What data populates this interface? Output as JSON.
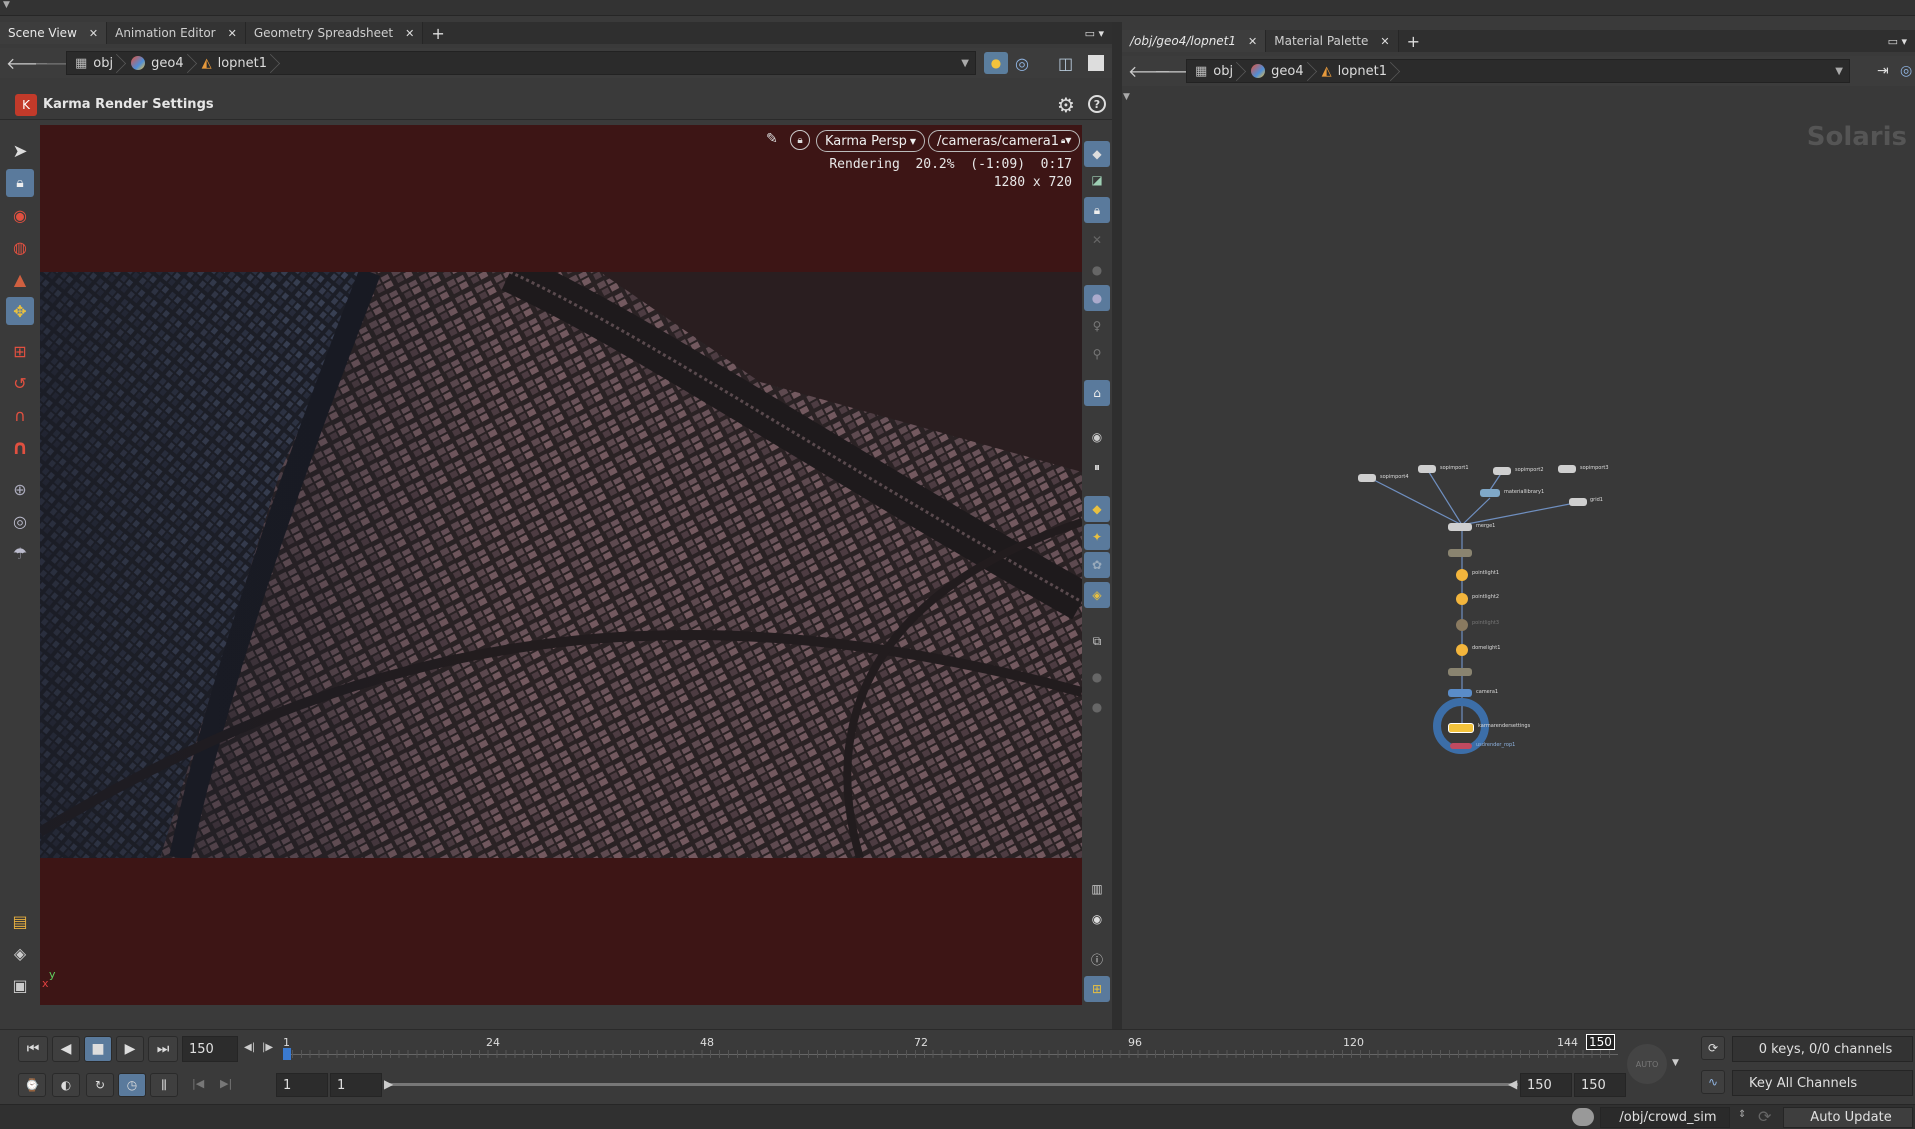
{
  "left_tabs": [
    {
      "label": "Scene View",
      "active": true
    },
    {
      "label": "Animation Editor",
      "active": false
    },
    {
      "label": "Geometry Spreadsheet",
      "active": false
    }
  ],
  "right_tabs": [
    {
      "label": "/obj/geo4/lopnet1",
      "active": true
    },
    {
      "label": "Material Palette",
      "active": false
    }
  ],
  "left_path": [
    "obj",
    "geo4",
    "lopnet1"
  ],
  "right_path": [
    "obj",
    "geo4",
    "lopnet1"
  ],
  "viewport": {
    "title": "Karma Render Settings",
    "camera_menu": "Karma Persp",
    "camera_path": "/cameras/camera1",
    "status_line": "Rendering  20.2%  (-1:09)  0:17",
    "resolution": "1280 x 720",
    "axis_x": "x",
    "axis_y": "y"
  },
  "network": {
    "context_label": "Solaris",
    "nodes": [
      {
        "label": "sopimport4"
      },
      {
        "label": "sopimport1"
      },
      {
        "label": "sopimport2"
      },
      {
        "label": "sopimport3"
      },
      {
        "label": "materiallibrary1"
      },
      {
        "label": "grid1"
      },
      {
        "label": "merge1"
      },
      {
        "label": "pointlight1"
      },
      {
        "label": "pointlight2"
      },
      {
        "label": "pointlight3"
      },
      {
        "label": "domelight1"
      },
      {
        "label": "camera1"
      },
      {
        "label": "karmarendersettings"
      },
      {
        "label": "usdrender_rop1"
      }
    ]
  },
  "playbar": {
    "current_frame": "150",
    "ticks": [
      "1",
      "24",
      "48",
      "72",
      "96",
      "120",
      "144"
    ],
    "end_marker": "150",
    "range_start": "1",
    "range_start2": "1",
    "range_end": "150",
    "range_end2": "150",
    "keys_label": "0 keys, 0/0 channels",
    "key_all": "Key All Channels",
    "auto_label": "AUTO"
  },
  "statusbar": {
    "path": "/obj/crowd_sim",
    "update": "Auto Update"
  },
  "colors": {
    "viewport_bg": "#3d1515",
    "accent_blue": "#3c6ea8",
    "node_yellow": "#f3b53c"
  }
}
